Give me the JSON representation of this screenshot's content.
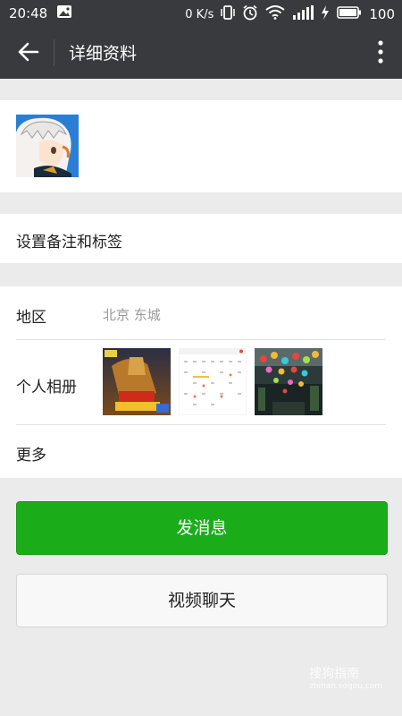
{
  "status_bar": {
    "time": "20:48",
    "net_speed": "0 K/s",
    "battery": "100",
    "icons": [
      "image-notification-icon",
      "vibrate-icon",
      "alarm-icon",
      "wifi-icon",
      "signal-icon",
      "charging-icon",
      "battery-icon"
    ]
  },
  "app_bar": {
    "title": "详细资料",
    "back_icon": "back-arrow-icon",
    "menu_icon": "more-vertical-icon"
  },
  "profile": {
    "avatar_icon": "anime-avatar"
  },
  "remark": {
    "label": "设置备注和标签"
  },
  "info": {
    "region_label": "地区",
    "region_value": "北京  东城",
    "album_label": "个人相册",
    "more_label": "更多"
  },
  "actions": {
    "message_label": "发消息",
    "video_label": "视频聊天"
  },
  "watermark": {
    "text": "搜狗指南",
    "sub": "zhinan.sogou.com"
  },
  "colors": {
    "bar": "#383a3d",
    "background": "#ebebeb",
    "primary_green": "#1aad19"
  }
}
